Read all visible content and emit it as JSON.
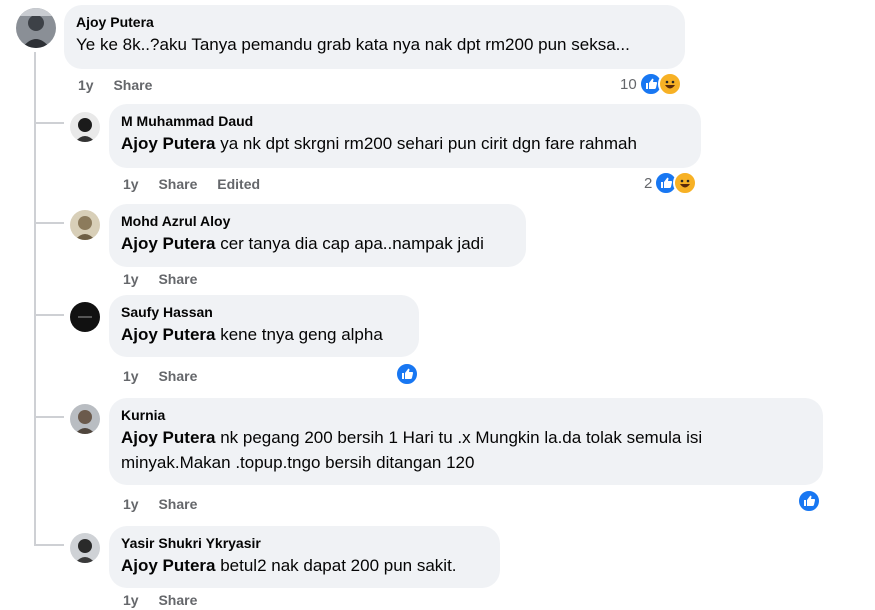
{
  "comments": [
    {
      "author": "Ajoy Putera",
      "mention": "",
      "text": "Ye ke 8k..?aku Tanya pemandu grab kata nya nak dpt rm200 pun seksa...",
      "time": "1y",
      "share": "Share",
      "edited": "",
      "reaction_count": "10",
      "reactions": [
        "like-icon",
        "haha-icon"
      ]
    },
    {
      "author": "M Muhammad Daud",
      "mention": "Ajoy Putera",
      "text": "ya nk dpt skrgni rm200 sehari pun cirit dgn fare rahmah",
      "time": "1y",
      "share": "Share",
      "edited": "Edited",
      "reaction_count": "2",
      "reactions": [
        "like-icon",
        "haha-icon"
      ]
    },
    {
      "author": "Mohd Azrul Aloy",
      "mention": "Ajoy Putera",
      "text": "cer tanya dia cap apa..nampak jadi",
      "time": "1y",
      "share": "Share",
      "edited": "",
      "reaction_count": "",
      "reactions": []
    },
    {
      "author": "Saufy Hassan",
      "mention": "Ajoy Putera",
      "text": "kene tnya geng alpha",
      "time": "1y",
      "share": "Share",
      "edited": "",
      "reaction_count": "",
      "reactions": [
        "like-icon"
      ]
    },
    {
      "author": "Kurnia",
      "mention": "Ajoy Putera",
      "text": "nk pegang 200 bersih 1 Hari tu .x Mungkin la.da tolak semula isi minyak.Makan .topup.tngo bersih ditangan 120",
      "time": "1y",
      "share": "Share",
      "edited": "",
      "reaction_count": "",
      "reactions": [
        "like-icon"
      ]
    },
    {
      "author": "Yasir Shukri Ykryasir",
      "mention": "Ajoy Putera",
      "text": "betul2 nak dapat 200 pun sakit.",
      "time": "1y",
      "share": "Share",
      "edited": "",
      "reaction_count": "",
      "reactions": []
    }
  ],
  "colors": {
    "bubble": "#f0f2f5",
    "secondary_text": "#65676b",
    "like_blue": "#1877f2",
    "haha_yellow": "#f7b125",
    "thread_line": "#ced0d4"
  }
}
